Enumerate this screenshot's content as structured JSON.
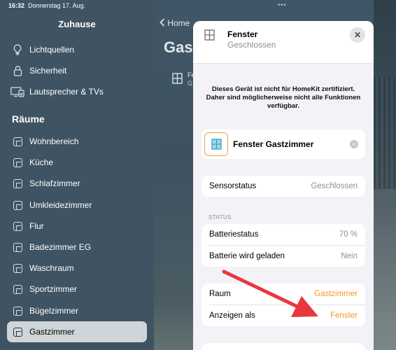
{
  "status_bar": {
    "time": "16:32",
    "date": "Donnerstag 17. Aug.",
    "dots": "•••"
  },
  "sidebar": {
    "title": "Zuhause",
    "items": [
      {
        "label": "Lichtquellen",
        "icon": "lightbulb-icon"
      },
      {
        "label": "Sicherheit",
        "icon": "lock-icon"
      },
      {
        "label": "Lautsprecher & TVs",
        "icon": "tv-icon"
      }
    ],
    "section_title": "Räume",
    "rooms": [
      {
        "label": "Wohnbereich"
      },
      {
        "label": "Küche"
      },
      {
        "label": "Schlafzimmer"
      },
      {
        "label": "Umkleidezimmer"
      },
      {
        "label": "Flur"
      },
      {
        "label": "Badezimmer EG"
      },
      {
        "label": "Waschraum"
      },
      {
        "label": "Sportzimmer"
      },
      {
        "label": "Bügelzimmer"
      },
      {
        "label": "Gastzimmer"
      }
    ],
    "selected_room": "Gastzimmer"
  },
  "background": {
    "back_label": "Home",
    "title": "Gas",
    "tile_name": "Fe",
    "tile_sub": "G"
  },
  "modal": {
    "title": "Fenster",
    "subtitle": "Geschlossen",
    "close_symbol": "✕",
    "warning": "Dieses Gerät ist nicht für HomeKit zertifiziert. Daher sind möglicherweise nicht alle Funktionen verfügbar.",
    "accessory_name": "Fenster Gastzimmer",
    "clear_symbol": "×",
    "sensor_row": {
      "label": "Sensorstatus",
      "value": "Geschlossen"
    },
    "status_section": "STATUS",
    "battery_rows": [
      {
        "label": "Batteriestatus",
        "value": "70 %"
      },
      {
        "label": "Batterie wird geladen",
        "value": "Nein"
      }
    ],
    "room_rows": [
      {
        "label": "Raum",
        "value": "Gastzimmer"
      },
      {
        "label": "Anzeigen als",
        "value": "Fenster"
      }
    ]
  },
  "colors": {
    "accent_orange": "#f09a1a",
    "annotation_arrow": "#e8373e"
  }
}
